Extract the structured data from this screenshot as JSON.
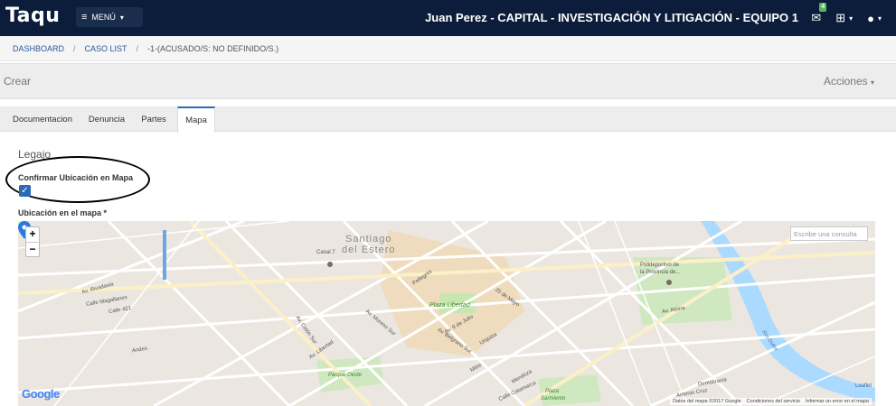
{
  "app": {
    "logo": "Taqu",
    "menu_label": "MENÚ"
  },
  "header": {
    "user_line": "Juan Perez - CAPITAL - INVESTIGACIÓN Y LITIGACIÓN - EQUIPO 1",
    "inbox_badge": "4"
  },
  "breadcrumb": {
    "items": [
      "DASHBOARD",
      "CASO LIST",
      "-1-(ACUSADO/S: NO DEFINIDO/S.)"
    ],
    "separator": "/"
  },
  "titlebar": {
    "title": "Crear",
    "actions_label": "Acciones"
  },
  "tabs": [
    {
      "label": "Documentacion",
      "active": false
    },
    {
      "label": "Denuncia",
      "active": false
    },
    {
      "label": "Partes",
      "active": false
    },
    {
      "label": "Mapa",
      "active": true
    }
  ],
  "form": {
    "section_title": "Legajo",
    "confirm_label": "Confirmar Ubicación en Mapa",
    "confirm_checked": true,
    "map_label": "Ubicación en el mapa *"
  },
  "map": {
    "zoom_in": "+",
    "zoom_out": "−",
    "search_placeholder": "Escribe una consulta",
    "provider": "Google",
    "leaflet": "Leaflet",
    "attribution": [
      "Datos del mapa ©2017 Google",
      "Condiciones del servicio",
      "Informar un error en el mapa"
    ],
    "labels": {
      "santiago": "Santiago",
      "del_estero": "del Estero",
      "plaza_libertad": "Plaza Libertad",
      "canal7": "Canal 7",
      "polideportivo_1": "Polideportivo de",
      "polideportivo_2": "la Provincia de...",
      "parque_oeste": "Parque Oeste",
      "plaza_sarmiento_1": "Plaza",
      "plaza_sarmiento_2": "Sarmiento",
      "rio_dulce": "Río Dulce",
      "av_alsina": "Av. Alsina",
      "av_rivadavia": "Av. Rivadavia",
      "av_belgrano_sur": "Av. Belgrano Sur",
      "av_libertad": "Av. Libertad",
      "pellegrini": "Pellegrini",
      "calle_magallanes": "Calle Magallanes",
      "democracia": "Democracia",
      "antonio_cruz": "Antonio Cruz",
      "mitre": "Mitre",
      "urquiza": "Urquiza",
      "calle_catamarca": "Calle Catamarca",
      "calle_421": "Calle 421",
      "andes": "Andes",
      "mendoza": "Mendoza",
      "av_moreno_sur": "Av. Moreno Sur",
      "av_9_julio": "Av. 9 de Julio",
      "av_25_mayo": "25 de Mayo",
      "av_colon_sur": "Av. Colón Sur"
    }
  },
  "colors": {
    "topbar": "#0c1d3c",
    "accent": "#2a6ab6",
    "pin": "#2a7ae2"
  }
}
